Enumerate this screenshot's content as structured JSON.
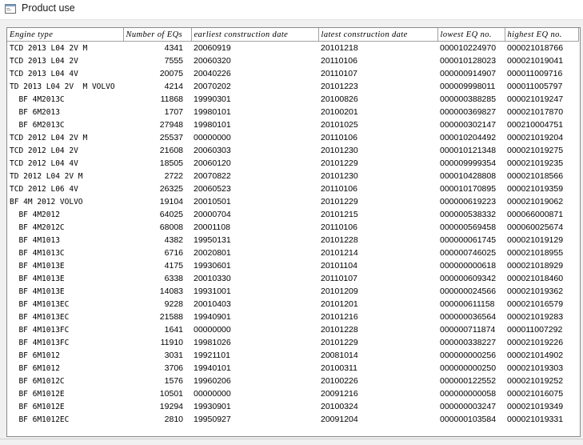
{
  "window": {
    "title": "Product use",
    "icon": "app-icon"
  },
  "table": {
    "columns": [
      "Engine type",
      "Number of EQs",
      "earliest construction date",
      "latest construction date",
      "lowest EQ no.",
      "highest EQ no."
    ],
    "rows": [
      [
        "TCD 2013 L04 2V M",
        "4341",
        "20060919",
        "20101218",
        "000010224970",
        "000021018766"
      ],
      [
        "TCD 2013 L04 2V",
        "7555",
        "20060320",
        "20110106",
        "000010128023",
        "000021019041"
      ],
      [
        "TCD 2013 L04 4V",
        "20075",
        "20040226",
        "20110107",
        "000000914907",
        "000011009716"
      ],
      [
        "TD 2013 L04 2V  M VOLVO",
        "4214",
        "20070202",
        "20101223",
        "000009998011",
        "000011005797"
      ],
      [
        "  BF 4M2013C",
        "11868",
        "19990301",
        "20100826",
        "000000388285",
        "000021019247"
      ],
      [
        "  BF 6M2013",
        "1707",
        "19980101",
        "20100201",
        "000000369827",
        "000021017870"
      ],
      [
        "  BF 6M2013C",
        "27948",
        "19980101",
        "20101025",
        "000000302147",
        "000210004751"
      ],
      [
        "TCD 2012 L04 2V M",
        "25537",
        "00000000",
        "20110106",
        "000010204492",
        "000021019204"
      ],
      [
        "TCD 2012 L04 2V",
        "21608",
        "20060303",
        "20101230",
        "000010121348",
        "000021019275"
      ],
      [
        "TCD 2012 L04 4V",
        "18505",
        "20060120",
        "20101229",
        "000009999354",
        "000021019235"
      ],
      [
        "TD 2012 L04 2V M",
        "2722",
        "20070822",
        "20101230",
        "000010428808",
        "000021018566"
      ],
      [
        "TCD 2012 L06 4V",
        "26325",
        "20060523",
        "20110106",
        "000010170895",
        "000021019359"
      ],
      [
        "BF 4M 2012 VOLVO",
        "19104",
        "20010501",
        "20101229",
        "000000619223",
        "000021019062"
      ],
      [
        "  BF 4M2012",
        "64025",
        "20000704",
        "20101215",
        "000000538332",
        "000066000871"
      ],
      [
        "  BF 4M2012C",
        "68008",
        "20001108",
        "20110106",
        "000000569458",
        "000060025674"
      ],
      [
        "  BF 4M1013",
        "4382",
        "19950131",
        "20101228",
        "000000061745",
        "000021019129"
      ],
      [
        "  BF 4M1013C",
        "6716",
        "20020801",
        "20101214",
        "000000746025",
        "000021018955"
      ],
      [
        "  BF 4M1013E",
        "4175",
        "19930601",
        "20101104",
        "000000000618",
        "000021018929"
      ],
      [
        "  BF 4M1013E",
        "6338",
        "20010330",
        "20110107",
        "000000609342",
        "000021018460"
      ],
      [
        "  BF 4M1013E",
        "14083",
        "19931001",
        "20101209",
        "000000024566",
        "000021019362"
      ],
      [
        "  BF 4M1013EC",
        "9228",
        "20010403",
        "20101201",
        "000000611158",
        "000021016579"
      ],
      [
        "  BF 4M1013EC",
        "21588",
        "19940901",
        "20101216",
        "000000036564",
        "000021019283"
      ],
      [
        "  BF 4M1013FC",
        "1641",
        "00000000",
        "20101228",
        "000000711874",
        "000011007292"
      ],
      [
        "  BF 4M1013FC",
        "11910",
        "19981026",
        "20101229",
        "000000338227",
        "000021019226"
      ],
      [
        "  BF 6M1012",
        "3031",
        "19921101",
        "20081014",
        "000000000256",
        "000021014902"
      ],
      [
        "  BF 6M1012",
        "3706",
        "19940101",
        "20100311",
        "000000000250",
        "000021019303"
      ],
      [
        "  BF 6M1012C",
        "1576",
        "19960206",
        "20100226",
        "000000122552",
        "000021019252"
      ],
      [
        "  BF 6M1012E",
        "10501",
        "00000000",
        "20091216",
        "000000000058",
        "000021016075"
      ],
      [
        "  BF 6M1012E",
        "19294",
        "19930901",
        "20100324",
        "000000003247",
        "000021019349"
      ],
      [
        "  BF 6M1012EC",
        "2810",
        "19950927",
        "20091204",
        "000000103584",
        "000021019331"
      ]
    ]
  }
}
